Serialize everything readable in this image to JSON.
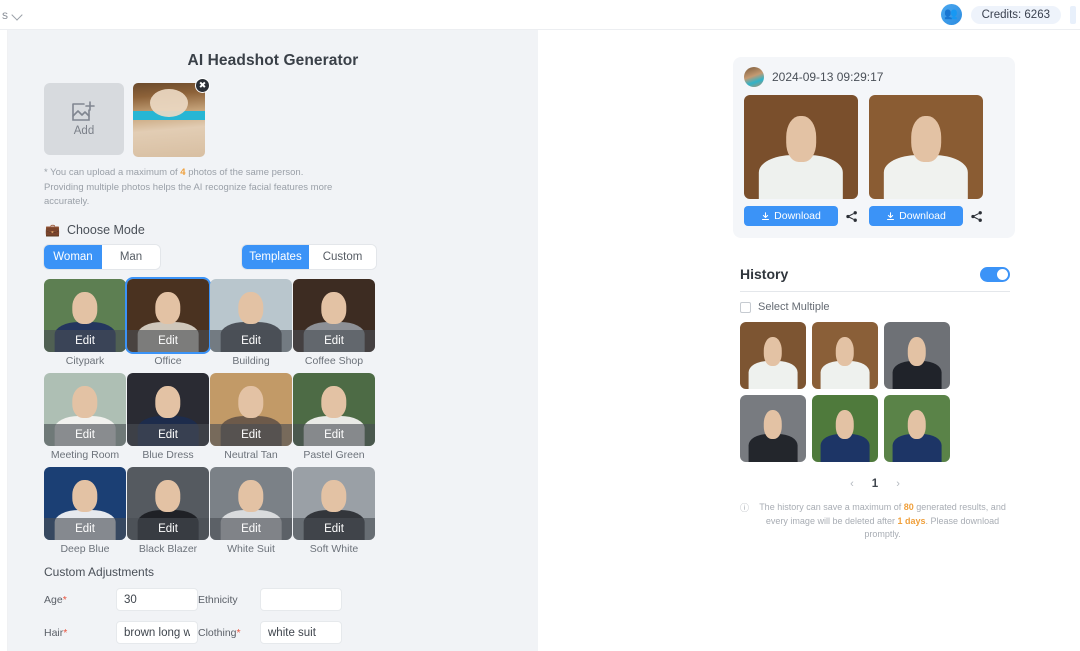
{
  "topbar": {
    "truncated_label": "s",
    "chevron_icon": "chevron-down-icon",
    "people_icon": "people-icon",
    "credits_label": "Credits: 6263"
  },
  "left_panel": {
    "title": "AI Headshot Generator",
    "upload": {
      "add_label": "Add",
      "add_icon": "image-plus-icon",
      "remove_icon": "close-icon"
    },
    "hint_prefix": "* You can upload a maximum of ",
    "hint_highlight": "4",
    "hint_suffix": " photos of the same person. Providing multiple photos helps the AI recognize facial features more accurately.",
    "choose_mode": {
      "icon": "briefcase-icon",
      "label": "Choose Mode",
      "gender": {
        "options": [
          "Woman",
          "Man"
        ],
        "selected": "Woman"
      },
      "source": {
        "options": [
          "Templates",
          "Custom"
        ],
        "selected": "Templates"
      }
    },
    "templates": {
      "edit_label": "Edit",
      "selected": "Office",
      "items": [
        {
          "name": "Citypark",
          "bg": "#5d7f52",
          "body": "#24365e"
        },
        {
          "name": "Office",
          "bg": "#4a3220",
          "body": "#cfc7bb"
        },
        {
          "name": "Building",
          "bg": "#b9c6cd",
          "body": "#4c5159"
        },
        {
          "name": "Coffee Shop",
          "bg": "#3d2c22",
          "body": "#8d9096"
        },
        {
          "name": "Meeting Room",
          "bg": "#aebfb4",
          "body": "#f1f1ee"
        },
        {
          "name": "Blue Dress",
          "bg": "#2a2b33",
          "body": "#1d2c4c"
        },
        {
          "name": "Neutral Tan",
          "bg": "#c29a67",
          "body": "#6d5a4a"
        },
        {
          "name": "Pastel Green",
          "bg": "#4d6b45",
          "body": "#e9eae6"
        },
        {
          "name": "Deep Blue",
          "bg": "#1b3f74",
          "body": "#e6e9ee"
        },
        {
          "name": "Black Blazer",
          "bg": "#555a60",
          "body": "#1f2126"
        },
        {
          "name": "White Suit",
          "bg": "#7b8187",
          "body": "#d9dbdd"
        },
        {
          "name": "Soft White",
          "bg": "#9aa0a6",
          "body": "#33363b"
        }
      ]
    },
    "custom_adjustments": {
      "title": "Custom Adjustments",
      "fields": [
        {
          "label": "Age",
          "required": true,
          "value": "30",
          "placeholder": ""
        },
        {
          "label": "Ethnicity",
          "required": false,
          "value": "",
          "placeholder": ""
        },
        {
          "label": "Hair",
          "required": true,
          "value": "brown long wavy",
          "placeholder": ""
        },
        {
          "label": "Clothing",
          "required": true,
          "value": "white suit",
          "placeholder": ""
        }
      ]
    }
  },
  "results": {
    "avatar_icon": "user-avatar",
    "timestamp": "2024-09-13 09:29:17",
    "download_label": "Download",
    "download_icon": "download-icon",
    "share_icon": "share-icon",
    "images": [
      {
        "bg": "#7a4f2c",
        "body": "#eef1ee"
      },
      {
        "bg": "#8a5c33",
        "body": "#f0f2ef"
      }
    ]
  },
  "history": {
    "title": "History",
    "toggle_on": true,
    "select_multiple_label": "Select Multiple",
    "thumbs": [
      {
        "bg": "#7d5532",
        "body": "#eef1ee"
      },
      {
        "bg": "#8a5f38",
        "body": "#eef1ee"
      },
      {
        "bg": "#6e7176",
        "body": "#20232a"
      },
      {
        "bg": "#787b80",
        "body": "#23262c"
      },
      {
        "bg": "#4f7a3c",
        "body": "#1d3566"
      },
      {
        "bg": "#5a8348",
        "body": "#1d3566"
      }
    ],
    "pagination": {
      "prev_icon": "chevron-left-icon",
      "page": "1",
      "next_icon": "chevron-right-icon"
    },
    "notice_icon": "info-icon",
    "notice_part1": "The history can save a maximum of ",
    "notice_max": "80",
    "notice_part2": " generated results, and every image will be deleted after ",
    "notice_days": "1 days",
    "notice_part3": ". Please download promptly."
  }
}
